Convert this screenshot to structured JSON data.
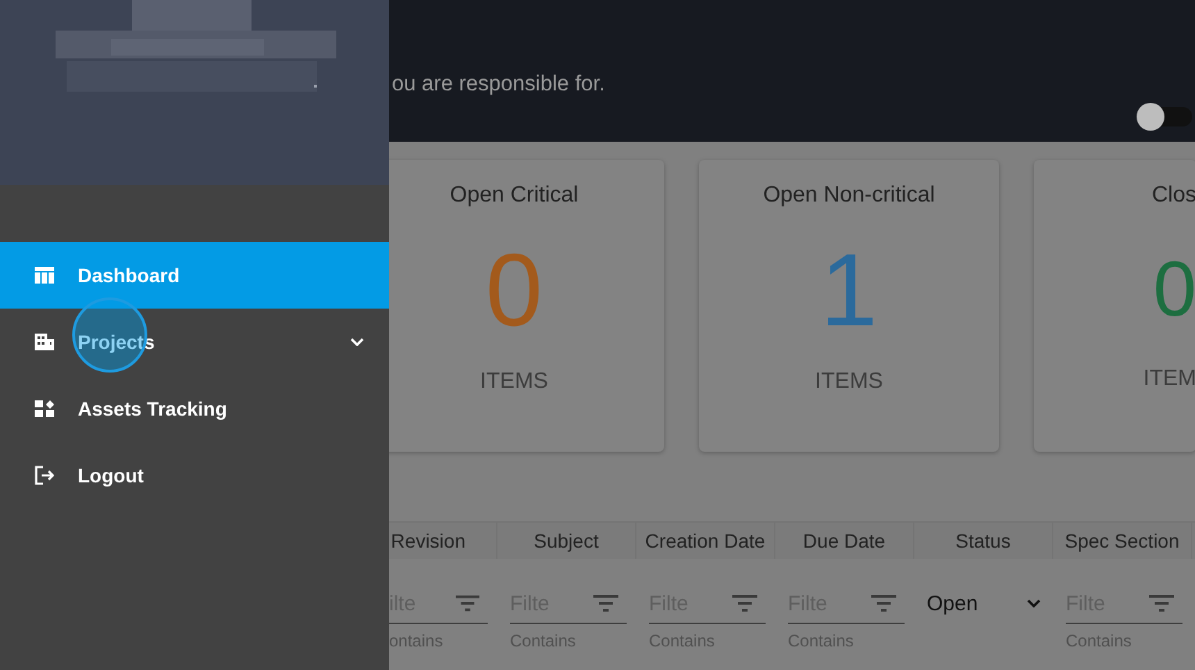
{
  "sidebar": {
    "items": [
      {
        "label": "Dashboard",
        "selected": true,
        "expandable": false
      },
      {
        "label": "Projects",
        "selected": false,
        "expandable": true,
        "expanded": false
      },
      {
        "label": "Assets Tracking",
        "selected": false,
        "expandable": false
      },
      {
        "label": "Logout",
        "selected": false,
        "expandable": false
      }
    ]
  },
  "header": {
    "subtitle": "ou are responsible for.",
    "toggle": {
      "on": false
    }
  },
  "cards": [
    {
      "title": "Open Critical",
      "count": "0",
      "unit": "ITEMS",
      "color": "#a35a1c"
    },
    {
      "title": "Open Non-critical",
      "count": "1",
      "unit": "ITEMS",
      "color": "#2b6a9c"
    },
    {
      "title": "Clos",
      "count": "0",
      "unit": "ITEM",
      "color": "#1d6e40"
    }
  ],
  "table": {
    "columns": [
      {
        "label": "Revision",
        "kind": "text",
        "placeholder": "ilte",
        "mode": "ontains"
      },
      {
        "label": "Subject",
        "kind": "text",
        "placeholder": "Filte",
        "mode": "Contains"
      },
      {
        "label": "Creation Date",
        "kind": "text",
        "placeholder": "Filte",
        "mode": "Contains"
      },
      {
        "label": "Due Date",
        "kind": "text",
        "placeholder": "Filte",
        "mode": "Contains"
      },
      {
        "label": "Status",
        "kind": "select",
        "value": "Open"
      },
      {
        "label": "Spec Section",
        "kind": "text",
        "placeholder": "Filte",
        "mode": "Contains"
      }
    ]
  }
}
